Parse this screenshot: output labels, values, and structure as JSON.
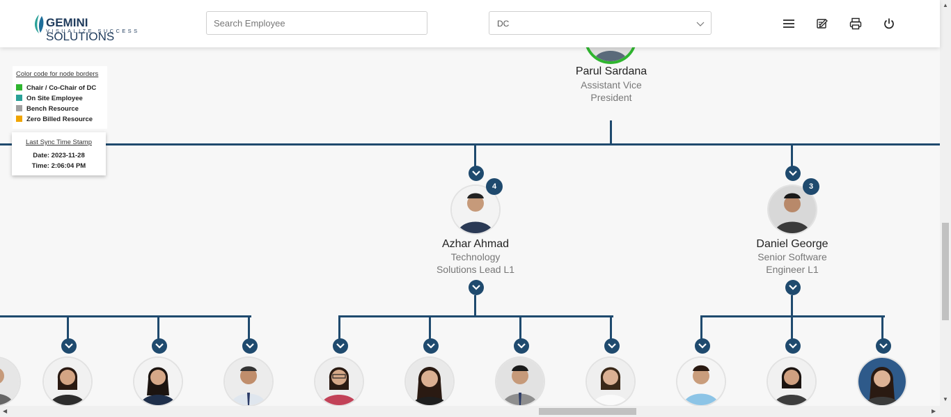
{
  "header": {
    "logo_main": "GEMINI",
    "logo_second": "SOLUTIONS",
    "logo_tagline": "VISUALIZE SUCCESS",
    "search_placeholder": "Search Employee",
    "dept_select_value": "DC",
    "icons": [
      "menu-icon",
      "edit-icon",
      "print-icon",
      "power-icon"
    ]
  },
  "legend": {
    "title": "Color code for node borders",
    "items": [
      {
        "label": "Chair / Co-Chair of DC",
        "color": "#2fb52f"
      },
      {
        "label": "On Site Employee",
        "color": "#2aa198"
      },
      {
        "label": "Bench Resource",
        "color": "#a0a0a0"
      },
      {
        "label": "Zero Billed Resource",
        "color": "#f0a500"
      }
    ]
  },
  "sync": {
    "title": "Last Sync Time Stamp",
    "date": "Date: 2023-11-28",
    "time": "Time: 2:06:04 PM"
  },
  "top_person": {
    "name": "Parul Sardana",
    "role_line1": "Assistant Vice",
    "role_line2": "President",
    "border_color": "#2fb52f"
  },
  "managers": [
    {
      "name": "Azhar Ahmad",
      "role_line1": "Technology",
      "role_line2": "Solutions Lead L1",
      "reports": "4"
    },
    {
      "name": "Daniel George",
      "role_line1": "Senior Software",
      "role_line2": "Engineer L1",
      "reports": "3"
    }
  ],
  "colors": {
    "accent": "#1f4a6e",
    "chair": "#2fb52f"
  }
}
